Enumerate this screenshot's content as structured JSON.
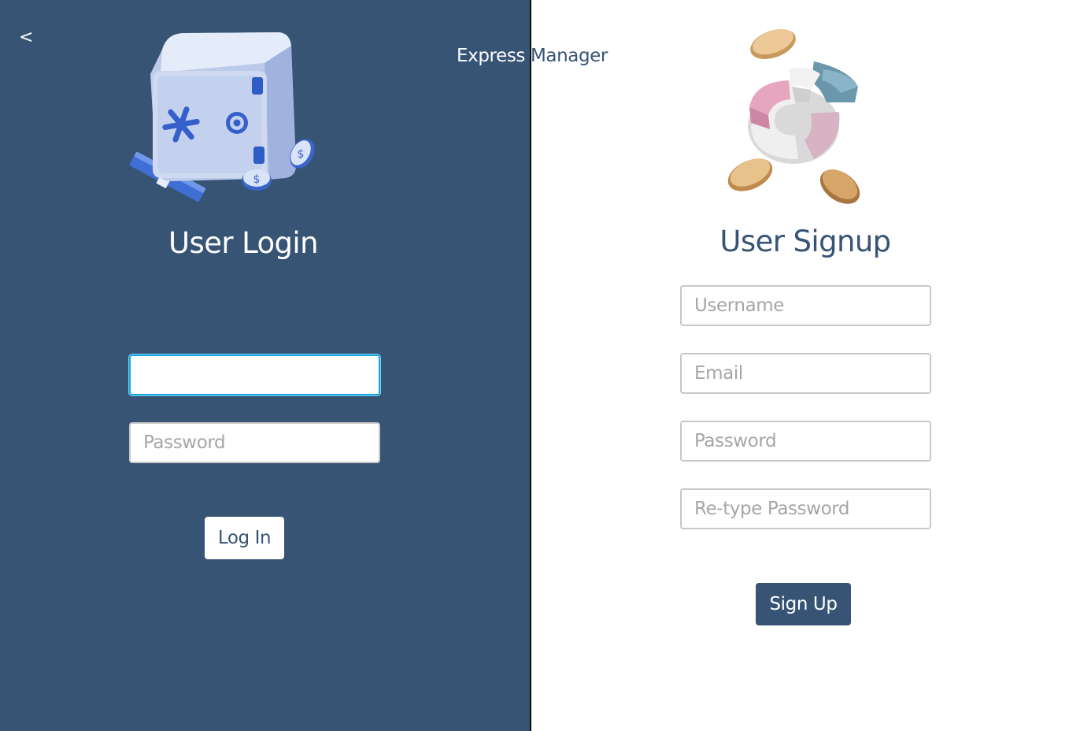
{
  "nav": {
    "back_label": "<"
  },
  "brand": {
    "word1": "Express",
    "word2": "Manager"
  },
  "login": {
    "title": "User Login",
    "illustration_icon": "safe-icon",
    "username_value": "",
    "password_placeholder": "Password",
    "button_label": "Log In"
  },
  "signup": {
    "title": "User Signup",
    "illustration_icon": "pie-chart-coins-icon",
    "username_placeholder": "Username",
    "email_placeholder": "Email",
    "password_placeholder": "Password",
    "retype_password_placeholder": "Re-type Password",
    "button_label": "Sign Up"
  },
  "colors": {
    "primary": "#375475",
    "background_right": "#ffffff",
    "focus_ring": "#1aa6e0",
    "input_border": "#c8c8c8"
  }
}
